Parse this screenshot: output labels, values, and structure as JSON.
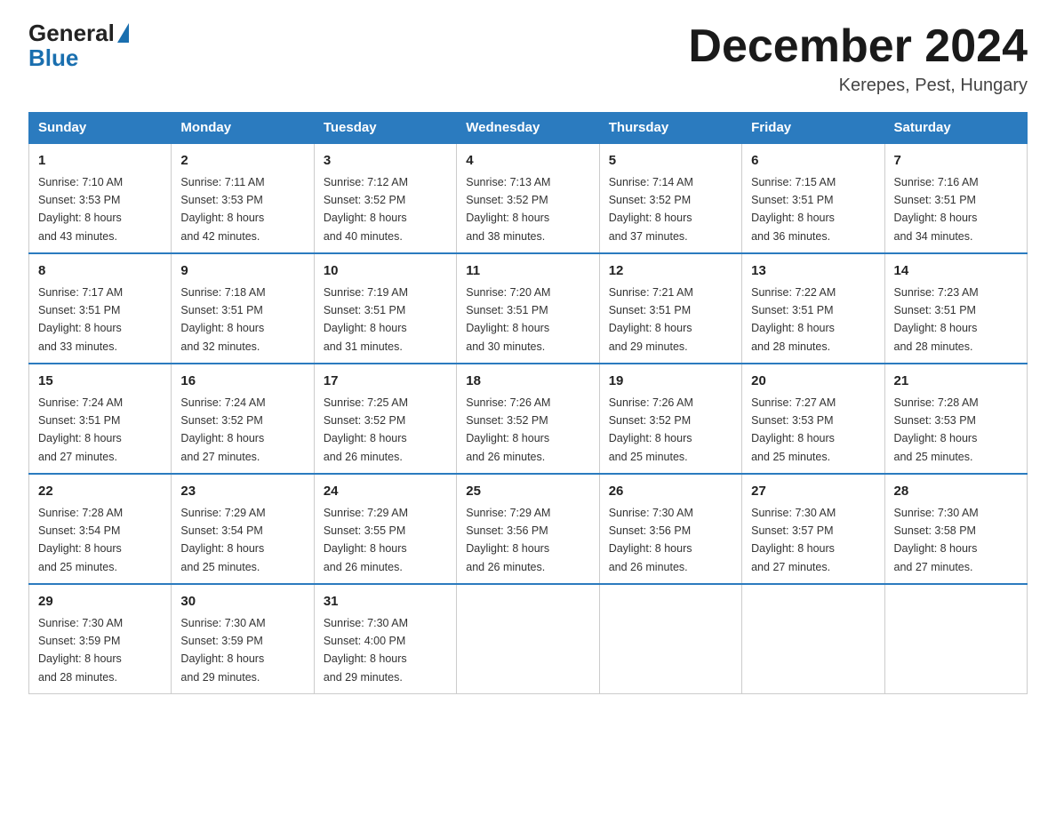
{
  "header": {
    "logo_general": "General",
    "logo_blue": "Blue",
    "month_title": "December 2024",
    "location": "Kerepes, Pest, Hungary"
  },
  "columns": [
    "Sunday",
    "Monday",
    "Tuesday",
    "Wednesday",
    "Thursday",
    "Friday",
    "Saturday"
  ],
  "weeks": [
    [
      {
        "day": "1",
        "sunrise": "Sunrise: 7:10 AM",
        "sunset": "Sunset: 3:53 PM",
        "daylight": "Daylight: 8 hours",
        "minutes": "and 43 minutes."
      },
      {
        "day": "2",
        "sunrise": "Sunrise: 7:11 AM",
        "sunset": "Sunset: 3:53 PM",
        "daylight": "Daylight: 8 hours",
        "minutes": "and 42 minutes."
      },
      {
        "day": "3",
        "sunrise": "Sunrise: 7:12 AM",
        "sunset": "Sunset: 3:52 PM",
        "daylight": "Daylight: 8 hours",
        "minutes": "and 40 minutes."
      },
      {
        "day": "4",
        "sunrise": "Sunrise: 7:13 AM",
        "sunset": "Sunset: 3:52 PM",
        "daylight": "Daylight: 8 hours",
        "minutes": "and 38 minutes."
      },
      {
        "day": "5",
        "sunrise": "Sunrise: 7:14 AM",
        "sunset": "Sunset: 3:52 PM",
        "daylight": "Daylight: 8 hours",
        "minutes": "and 37 minutes."
      },
      {
        "day": "6",
        "sunrise": "Sunrise: 7:15 AM",
        "sunset": "Sunset: 3:51 PM",
        "daylight": "Daylight: 8 hours",
        "minutes": "and 36 minutes."
      },
      {
        "day": "7",
        "sunrise": "Sunrise: 7:16 AM",
        "sunset": "Sunset: 3:51 PM",
        "daylight": "Daylight: 8 hours",
        "minutes": "and 34 minutes."
      }
    ],
    [
      {
        "day": "8",
        "sunrise": "Sunrise: 7:17 AM",
        "sunset": "Sunset: 3:51 PM",
        "daylight": "Daylight: 8 hours",
        "minutes": "and 33 minutes."
      },
      {
        "day": "9",
        "sunrise": "Sunrise: 7:18 AM",
        "sunset": "Sunset: 3:51 PM",
        "daylight": "Daylight: 8 hours",
        "minutes": "and 32 minutes."
      },
      {
        "day": "10",
        "sunrise": "Sunrise: 7:19 AM",
        "sunset": "Sunset: 3:51 PM",
        "daylight": "Daylight: 8 hours",
        "minutes": "and 31 minutes."
      },
      {
        "day": "11",
        "sunrise": "Sunrise: 7:20 AM",
        "sunset": "Sunset: 3:51 PM",
        "daylight": "Daylight: 8 hours",
        "minutes": "and 30 minutes."
      },
      {
        "day": "12",
        "sunrise": "Sunrise: 7:21 AM",
        "sunset": "Sunset: 3:51 PM",
        "daylight": "Daylight: 8 hours",
        "minutes": "and 29 minutes."
      },
      {
        "day": "13",
        "sunrise": "Sunrise: 7:22 AM",
        "sunset": "Sunset: 3:51 PM",
        "daylight": "Daylight: 8 hours",
        "minutes": "and 28 minutes."
      },
      {
        "day": "14",
        "sunrise": "Sunrise: 7:23 AM",
        "sunset": "Sunset: 3:51 PM",
        "daylight": "Daylight: 8 hours",
        "minutes": "and 28 minutes."
      }
    ],
    [
      {
        "day": "15",
        "sunrise": "Sunrise: 7:24 AM",
        "sunset": "Sunset: 3:51 PM",
        "daylight": "Daylight: 8 hours",
        "minutes": "and 27 minutes."
      },
      {
        "day": "16",
        "sunrise": "Sunrise: 7:24 AM",
        "sunset": "Sunset: 3:52 PM",
        "daylight": "Daylight: 8 hours",
        "minutes": "and 27 minutes."
      },
      {
        "day": "17",
        "sunrise": "Sunrise: 7:25 AM",
        "sunset": "Sunset: 3:52 PM",
        "daylight": "Daylight: 8 hours",
        "minutes": "and 26 minutes."
      },
      {
        "day": "18",
        "sunrise": "Sunrise: 7:26 AM",
        "sunset": "Sunset: 3:52 PM",
        "daylight": "Daylight: 8 hours",
        "minutes": "and 26 minutes."
      },
      {
        "day": "19",
        "sunrise": "Sunrise: 7:26 AM",
        "sunset": "Sunset: 3:52 PM",
        "daylight": "Daylight: 8 hours",
        "minutes": "and 25 minutes."
      },
      {
        "day": "20",
        "sunrise": "Sunrise: 7:27 AM",
        "sunset": "Sunset: 3:53 PM",
        "daylight": "Daylight: 8 hours",
        "minutes": "and 25 minutes."
      },
      {
        "day": "21",
        "sunrise": "Sunrise: 7:28 AM",
        "sunset": "Sunset: 3:53 PM",
        "daylight": "Daylight: 8 hours",
        "minutes": "and 25 minutes."
      }
    ],
    [
      {
        "day": "22",
        "sunrise": "Sunrise: 7:28 AM",
        "sunset": "Sunset: 3:54 PM",
        "daylight": "Daylight: 8 hours",
        "minutes": "and 25 minutes."
      },
      {
        "day": "23",
        "sunrise": "Sunrise: 7:29 AM",
        "sunset": "Sunset: 3:54 PM",
        "daylight": "Daylight: 8 hours",
        "minutes": "and 25 minutes."
      },
      {
        "day": "24",
        "sunrise": "Sunrise: 7:29 AM",
        "sunset": "Sunset: 3:55 PM",
        "daylight": "Daylight: 8 hours",
        "minutes": "and 26 minutes."
      },
      {
        "day": "25",
        "sunrise": "Sunrise: 7:29 AM",
        "sunset": "Sunset: 3:56 PM",
        "daylight": "Daylight: 8 hours",
        "minutes": "and 26 minutes."
      },
      {
        "day": "26",
        "sunrise": "Sunrise: 7:30 AM",
        "sunset": "Sunset: 3:56 PM",
        "daylight": "Daylight: 8 hours",
        "minutes": "and 26 minutes."
      },
      {
        "day": "27",
        "sunrise": "Sunrise: 7:30 AM",
        "sunset": "Sunset: 3:57 PM",
        "daylight": "Daylight: 8 hours",
        "minutes": "and 27 minutes."
      },
      {
        "day": "28",
        "sunrise": "Sunrise: 7:30 AM",
        "sunset": "Sunset: 3:58 PM",
        "daylight": "Daylight: 8 hours",
        "minutes": "and 27 minutes."
      }
    ],
    [
      {
        "day": "29",
        "sunrise": "Sunrise: 7:30 AM",
        "sunset": "Sunset: 3:59 PM",
        "daylight": "Daylight: 8 hours",
        "minutes": "and 28 minutes."
      },
      {
        "day": "30",
        "sunrise": "Sunrise: 7:30 AM",
        "sunset": "Sunset: 3:59 PM",
        "daylight": "Daylight: 8 hours",
        "minutes": "and 29 minutes."
      },
      {
        "day": "31",
        "sunrise": "Sunrise: 7:30 AM",
        "sunset": "Sunset: 4:00 PM",
        "daylight": "Daylight: 8 hours",
        "minutes": "and 29 minutes."
      },
      null,
      null,
      null,
      null
    ]
  ]
}
